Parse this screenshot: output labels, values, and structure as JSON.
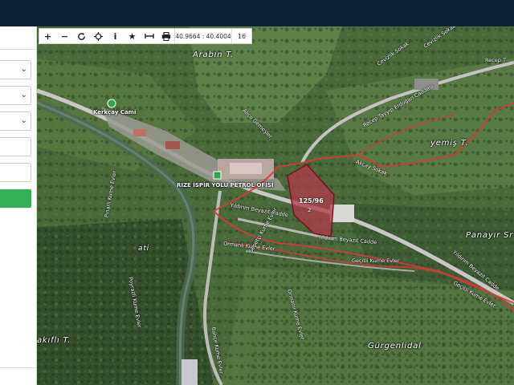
{
  "toolbar": {
    "tools": [
      {
        "name": "zoom-in-icon",
        "glyph": "+"
      },
      {
        "name": "zoom-out-icon",
        "glyph": "−"
      },
      {
        "name": "refresh-icon",
        "glyph": ""
      },
      {
        "name": "locate-icon",
        "glyph": ""
      },
      {
        "name": "info-icon",
        "glyph": "i"
      },
      {
        "name": "star-icon",
        "glyph": "★"
      },
      {
        "name": "measure-icon",
        "glyph": ""
      },
      {
        "name": "print-icon",
        "glyph": ""
      }
    ],
    "coordinates": "40.9664 : 40.4004",
    "zoom_level": "16"
  },
  "map": {
    "places": {
      "arabin": "Arabın T.",
      "yemis": "yemiş T.",
      "panayir": "Panayır Sr",
      "gurgenlidal": "Gürgenlidal",
      "akifli": "akıflı T.",
      "ati": "ati"
    },
    "pois": {
      "mosque": "Kerkçay Cami",
      "fuel": "RIZE İSPİR YOLU PETROL OFİSİ"
    },
    "roads": {
      "cevizlik": "Cevizlik Sokak",
      "recep_kurt": "Recep Tayyip Erdoğan Caddesi",
      "ilyas_kole": "Aliço Gemeşler",
      "akcay": "Akçay Sokak",
      "yildirim_beyazit": "Yıldırım Beyazıt Cadde",
      "yildirim_beyazit2": "Yıldırım Beyazıt Cadde",
      "yildirim_beyazit3": "Yıldırım Beyazıt Cadde",
      "ormanli": "Ormanlı Kume Evler",
      "gecitli": "Geçitli Kume Evler",
      "gecitli2": "Geçitli Kume Evler",
      "pinarli": "Pınarlı Kume Evler",
      "poyraz": "Poyrazli Kume Evler",
      "ormanli2": "Ormanlı Kume Evler",
      "bahce": "Bahçe Kume Evler",
      "sepetci": "Sepetçi Kume Evler",
      "cevizlik2": "Cevizlik Sokak",
      "recep": "Recep T"
    },
    "parcel": {
      "number": "125/96",
      "sub": "2"
    },
    "colors": {
      "parcel_fill": "#b23a4a",
      "boundary": "#d63a3a",
      "poi_green": "#2aa84a"
    }
  }
}
